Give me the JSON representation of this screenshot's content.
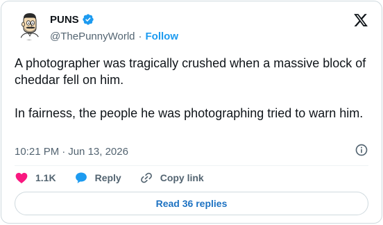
{
  "author": {
    "display_name": "PUNS",
    "handle": "@ThePunnyWorld",
    "separator": "·",
    "follow_label": "Follow",
    "verified_color": "#1d9bf0",
    "avatar_icon": "bearded-man-avatar-icon"
  },
  "tweet": {
    "paragraphs": [
      "A photographer was tragically crushed when a massive block of cheddar fell on him.",
      "In fairness, the people he was photographing tried to warn him."
    ]
  },
  "meta": {
    "time": "10:21 PM",
    "separator": "·",
    "date": "Jun 13, 2026"
  },
  "actions": {
    "like_count": "1.1K",
    "reply_label": "Reply",
    "copy_link_label": "Copy link"
  },
  "read_replies": {
    "label": "Read 36 replies"
  },
  "colors": {
    "accent": "#1d9bf0",
    "like": "#f91880",
    "text": "#0f1419",
    "muted": "#536471",
    "border": "#cfd9de"
  }
}
